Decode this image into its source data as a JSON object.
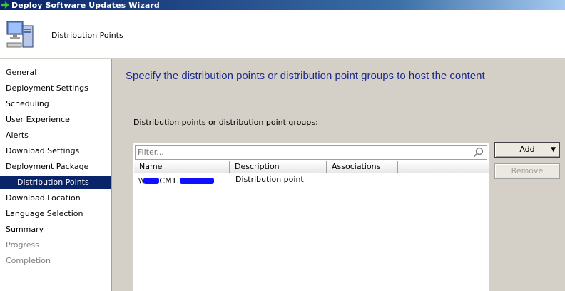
{
  "window": {
    "title": "Deploy Software Updates Wizard"
  },
  "header": {
    "title": "Distribution Points"
  },
  "sidebar": {
    "items": [
      {
        "label": "General",
        "state": "normal"
      },
      {
        "label": "Deployment Settings",
        "state": "normal"
      },
      {
        "label": "Scheduling",
        "state": "normal"
      },
      {
        "label": "User Experience",
        "state": "normal"
      },
      {
        "label": "Alerts",
        "state": "normal"
      },
      {
        "label": "Download Settings",
        "state": "normal"
      },
      {
        "label": "Deployment Package",
        "state": "normal"
      },
      {
        "label": "Distribution Points",
        "state": "active"
      },
      {
        "label": "Download Location",
        "state": "normal"
      },
      {
        "label": "Language Selection",
        "state": "normal"
      },
      {
        "label": "Summary",
        "state": "normal"
      },
      {
        "label": "Progress",
        "state": "disabled"
      },
      {
        "label": "Completion",
        "state": "disabled"
      }
    ]
  },
  "main": {
    "heading": "Specify the distribution points or distribution point groups to host the content",
    "list_label": "Distribution points or distribution point groups:",
    "filter": {
      "placeholder": "Filter..."
    },
    "columns": [
      "Name",
      "Description",
      "Associations"
    ],
    "rows": [
      {
        "name_prefix": "\\\\",
        "name_mid": "CM1.",
        "description": "Distribution point",
        "associations": ""
      }
    ],
    "buttons": {
      "add": "Add",
      "remove": "Remove"
    }
  },
  "colors": {
    "title_bar": "#0a246a",
    "selected_step": "#0a246a",
    "heading_text": "#1c2a8c",
    "redaction": "#1010ff"
  },
  "icons": {
    "title": "green-arrow-icon",
    "header": "computer-icon",
    "filter": "search-icon"
  }
}
